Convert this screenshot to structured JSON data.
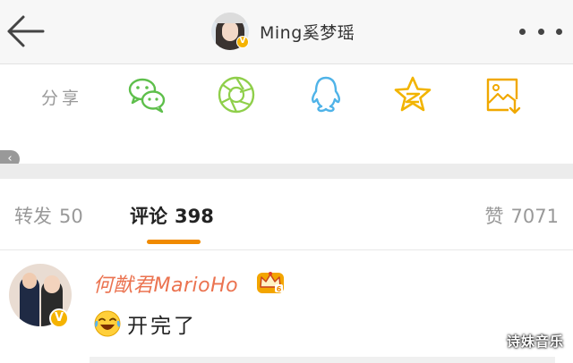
{
  "header": {
    "username": "Ming奚梦瑶",
    "verified_badge": "V",
    "icons": [
      "back-arrow-icon",
      "more-dots-icon"
    ]
  },
  "share": {
    "label": "分享",
    "targets": [
      {
        "name": "wechat",
        "icon": "wechat-icon",
        "color": "#5ebf4b"
      },
      {
        "name": "moments",
        "icon": "moments-aperture-icon",
        "color": "#8fcf4a"
      },
      {
        "name": "qq",
        "icon": "qq-penguin-icon",
        "color": "#4fb3e8"
      },
      {
        "name": "qzone",
        "icon": "qzone-star-icon",
        "color": "#f2b400"
      },
      {
        "name": "save-image",
        "icon": "save-image-icon",
        "color": "#f0a800"
      }
    ]
  },
  "scroll": {
    "glyph": "‹"
  },
  "tabs": {
    "repost": {
      "label": "转发",
      "count": "50"
    },
    "comment": {
      "label": "评论",
      "count": "398"
    },
    "like": {
      "label": "赞",
      "count": "7071"
    },
    "active": "comment",
    "accent": "#f08a00"
  },
  "comment": {
    "author": "何猷君MarioHo",
    "author_color": "#eb7350",
    "verified_badge": "V",
    "badge_icon": "crown-vip-badge-icon",
    "emoji_icon": "laugh-cry-emoji-icon",
    "text": "开完了"
  },
  "watermark": "诗妹音乐"
}
